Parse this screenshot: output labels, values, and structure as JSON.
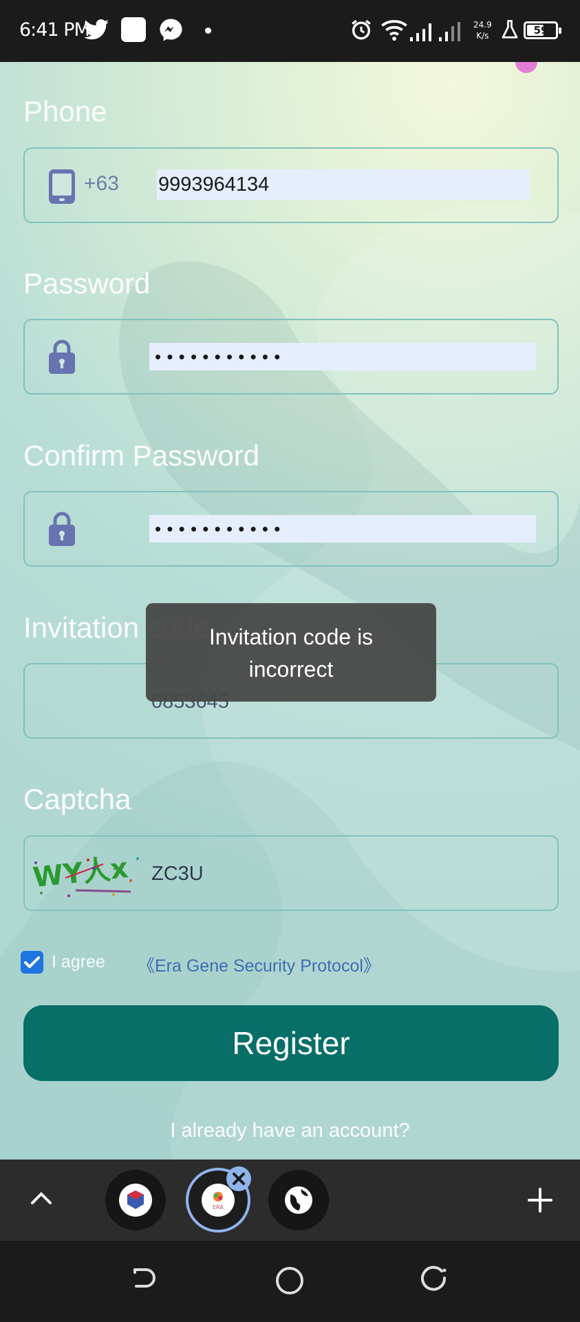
{
  "status_bar": {
    "time": "6:41 PM",
    "network_speed_value": "24.9",
    "network_speed_unit": "K/s",
    "battery": "59",
    "icons": [
      "twitter-icon",
      "app-square-icon",
      "messenger-icon",
      "dot-icon",
      "alarm-icon",
      "wifi-icon",
      "signal-icon",
      "signal-icon-2",
      "flask-icon",
      "battery-icon"
    ]
  },
  "form": {
    "phone": {
      "label": "Phone",
      "country_code": "+63",
      "value": "9993964134",
      "icon": "phone-icon"
    },
    "password": {
      "label": "Password",
      "value": "• • • • • • • • • • •",
      "icon": "lock-icon"
    },
    "confirm_password": {
      "label": "Confirm Password",
      "value": "• • • • • • • • • • •",
      "icon": "lock-icon"
    },
    "invitation": {
      "label": "Invitation code",
      "value": "0853645"
    },
    "captcha": {
      "label": "Captcha",
      "value": "ZC3U",
      "image_text": "WY人x"
    }
  },
  "toast": {
    "message": "Invitation code is incorrect"
  },
  "agree": {
    "checked": true,
    "text": "I agree",
    "link": "《Era Gene Security Protocol》"
  },
  "register_button": "Register",
  "account_link": "I already have an account?",
  "tab_bar": {
    "icons": [
      "chevron-up-icon",
      "tab-app-icon",
      "tab-era-icon",
      "tab-close-icon",
      "tab-globe-icon",
      "new-tab-plus-icon"
    ],
    "era_logo_text": "ERA"
  },
  "nav_bar": {
    "icons": [
      "back-icon",
      "home-icon",
      "recents-icon"
    ]
  },
  "colors": {
    "accent": "#076e68",
    "field_border": "#7fc2bd",
    "checkbox": "#1e74e0",
    "link": "#3d6eb4"
  }
}
